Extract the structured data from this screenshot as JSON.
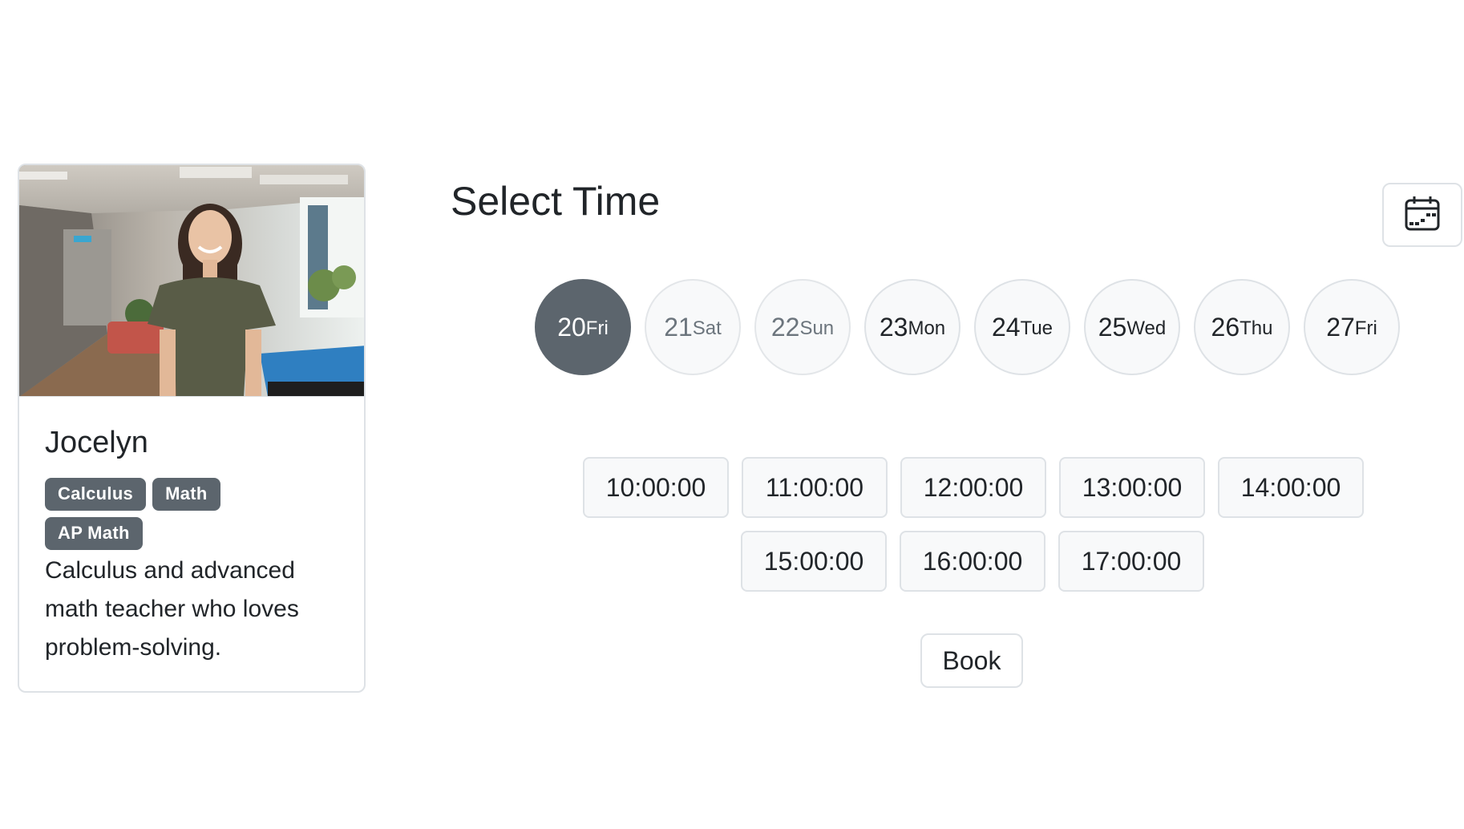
{
  "tutor": {
    "name": "Jocelyn",
    "tags": [
      "Calculus",
      "Math",
      "AP Math"
    ],
    "bio": "Calculus and advanced math teacher who loves problem-solving."
  },
  "schedule": {
    "title": "Select Time",
    "days": [
      {
        "num": "20",
        "dow": "Fri",
        "state": "active"
      },
      {
        "num": "21",
        "dow": "Sat",
        "state": "disabled"
      },
      {
        "num": "22",
        "dow": "Sun",
        "state": "disabled"
      },
      {
        "num": "23",
        "dow": "Mon",
        "state": "normal"
      },
      {
        "num": "24",
        "dow": "Tue",
        "state": "normal"
      },
      {
        "num": "25",
        "dow": "Wed",
        "state": "normal"
      },
      {
        "num": "26",
        "dow": "Thu",
        "state": "normal"
      },
      {
        "num": "27",
        "dow": "Fri",
        "state": "normal"
      }
    ],
    "times_row1": [
      "10:00:00",
      "11:00:00",
      "12:00:00",
      "13:00:00",
      "14:00:00"
    ],
    "times_row2": [
      "15:00:00",
      "16:00:00",
      "17:00:00"
    ],
    "book_label": "Book"
  },
  "icons": {
    "calendar": "calendar-icon"
  },
  "colors": {
    "active_day": "#5c656d",
    "tag_bg": "#5c656d",
    "border": "#dee2e6",
    "button_bg": "#f8f9fa"
  }
}
